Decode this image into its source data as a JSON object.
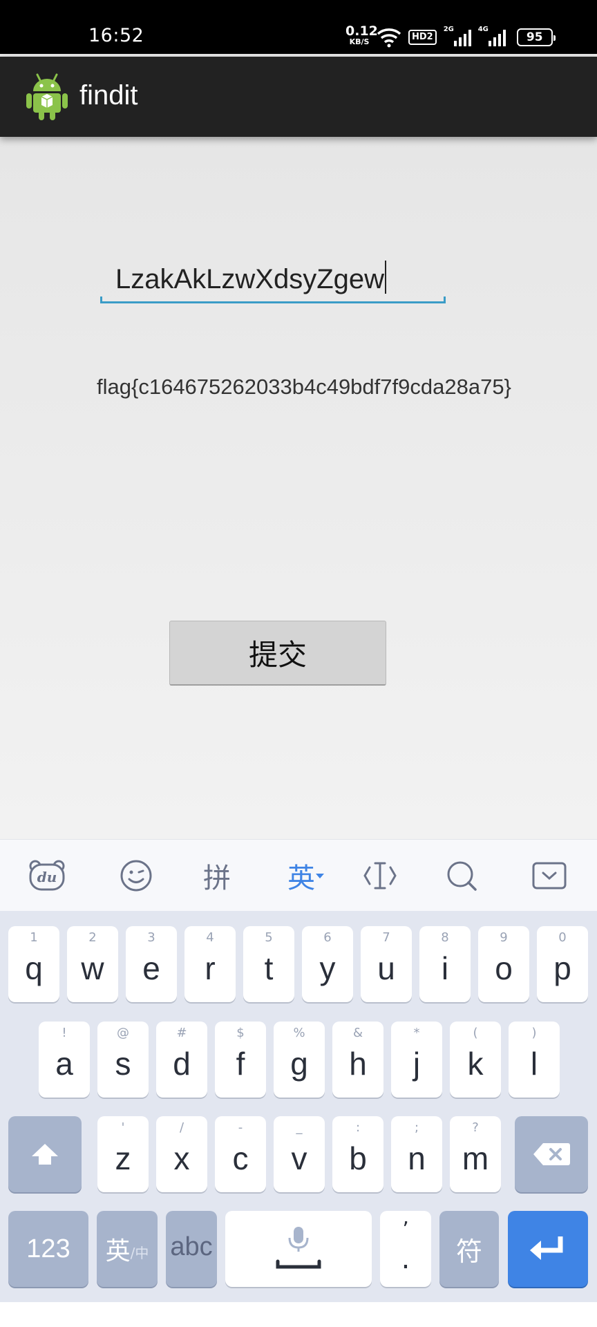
{
  "status_bar": {
    "time": "16:52",
    "net_speed_value": "0.12",
    "net_speed_unit": "KB/S",
    "hd_label": "HD2",
    "sim1_label": "2G",
    "sim2_label": "4G",
    "battery": "95"
  },
  "action_bar": {
    "title": "findit"
  },
  "form": {
    "input_value": "LzakAkLzwXdsyZgew",
    "result_text": "flag{c164675262033b4c49bdf7f9cda28a75}",
    "submit_label": "提交"
  },
  "keyboard_toolbar": {
    "pinyin_label": "拼",
    "english_label": "英"
  },
  "keyboard": {
    "row1": [
      {
        "ch": "q",
        "sym": "1"
      },
      {
        "ch": "w",
        "sym": "2"
      },
      {
        "ch": "e",
        "sym": "3"
      },
      {
        "ch": "r",
        "sym": "4"
      },
      {
        "ch": "t",
        "sym": "5"
      },
      {
        "ch": "y",
        "sym": "6"
      },
      {
        "ch": "u",
        "sym": "7"
      },
      {
        "ch": "i",
        "sym": "8"
      },
      {
        "ch": "o",
        "sym": "9"
      },
      {
        "ch": "p",
        "sym": "0"
      }
    ],
    "row2": [
      {
        "ch": "a",
        "sym": "!"
      },
      {
        "ch": "s",
        "sym": "@"
      },
      {
        "ch": "d",
        "sym": "#"
      },
      {
        "ch": "f",
        "sym": "$"
      },
      {
        "ch": "g",
        "sym": "%"
      },
      {
        "ch": "h",
        "sym": "&"
      },
      {
        "ch": "j",
        "sym": "*"
      },
      {
        "ch": "k",
        "sym": "("
      },
      {
        "ch": "l",
        "sym": ")"
      }
    ],
    "row3": [
      {
        "ch": "z",
        "sym": "'"
      },
      {
        "ch": "x",
        "sym": "/"
      },
      {
        "ch": "c",
        "sym": "-"
      },
      {
        "ch": "v",
        "sym": "_"
      },
      {
        "ch": "b",
        "sym": ":"
      },
      {
        "ch": "n",
        "sym": ";"
      },
      {
        "ch": "m",
        "sym": "?"
      }
    ],
    "num_label": "123",
    "lang_label": "英",
    "lang_sub": "/中",
    "abc_label": "abc",
    "punct_top": "’",
    "punct_bottom": ".",
    "symbols_label": "符"
  }
}
